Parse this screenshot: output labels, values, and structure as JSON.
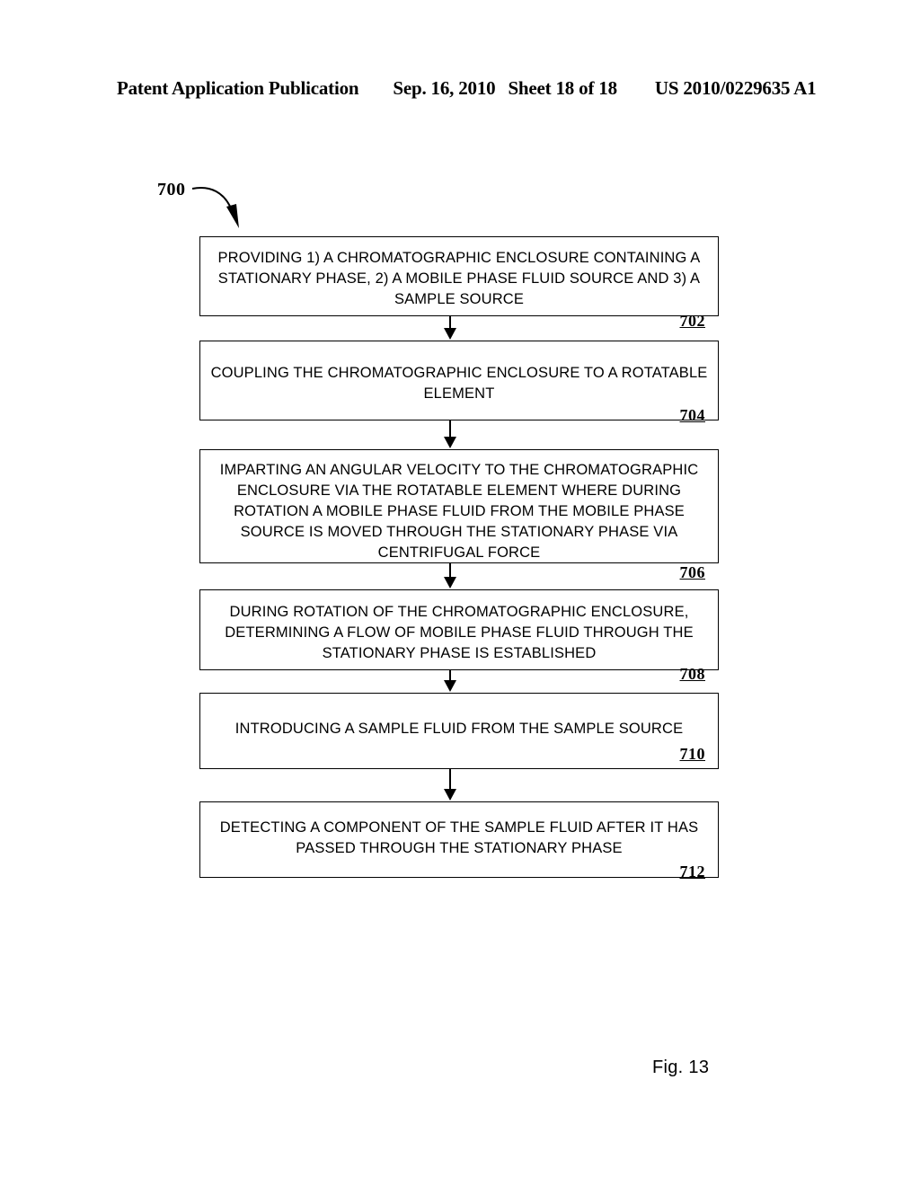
{
  "header": {
    "publication": "Patent Application Publication",
    "date": "Sep. 16, 2010",
    "sheet": "Sheet 18 of 18",
    "patent_number": "US 2010/0229635 A1"
  },
  "figure": {
    "diagram_label": "700",
    "caption": "Fig. 13",
    "steps": [
      {
        "id": "702",
        "text": "PROVIDING 1) A CHROMATOGRAPHIC ENCLOSURE CONTAINING A STATIONARY PHASE,  2) A MOBILE PHASE FLUID SOURCE AND 3) A SAMPLE SOURCE"
      },
      {
        "id": "704",
        "text": "COUPLING THE CHROMATOGRAPHIC ENCLOSURE TO A ROTATABLE ELEMENT"
      },
      {
        "id": "706",
        "text": "IMPARTING AN ANGULAR VELOCITY TO THE CHROMATOGRAPHIC ENCLOSURE VIA THE ROTATABLE ELEMENT WHERE DURING ROTATION A MOBILE PHASE FLUID FROM THE MOBILE PHASE SOURCE IS MOVED THROUGH THE STATIONARY PHASE VIA CENTRIFUGAL FORCE"
      },
      {
        "id": "708",
        "text": "DURING ROTATION OF THE CHROMATOGRAPHIC ENCLOSURE, DETERMINING A FLOW OF MOBILE PHASE FLUID THROUGH THE STATIONARY PHASE IS ESTABLISHED"
      },
      {
        "id": "710",
        "text": "INTRODUCING A SAMPLE FLUID FROM THE SAMPLE SOURCE"
      },
      {
        "id": "712",
        "text": "DETECTING A COMPONENT OF THE SAMPLE FLUID AFTER IT HAS PASSED THROUGH THE STATIONARY PHASE"
      }
    ]
  },
  "colors": {
    "ink": "#000000",
    "paper": "#ffffff"
  }
}
